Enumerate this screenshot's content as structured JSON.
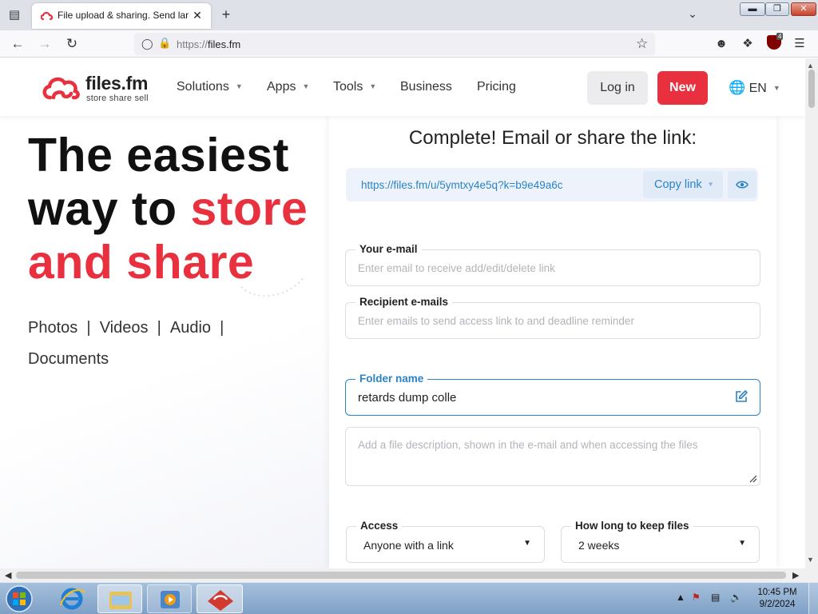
{
  "browser": {
    "tab_title": "File upload & sharing. Send large files",
    "url_scheme": "https://",
    "url_host": "files.fm",
    "ublock_count": "4"
  },
  "header": {
    "logo_name": "files.fm",
    "logo_tagline": "store  share  sell",
    "menu": {
      "solutions": "Solutions",
      "apps": "Apps",
      "tools": "Tools",
      "business": "Business",
      "pricing": "Pricing"
    },
    "login": "Log in",
    "new": "New",
    "language": "EN"
  },
  "hero": {
    "line1": "The easiest",
    "line2a": "way to ",
    "line2b": "store",
    "line3": "and share",
    "links": [
      "Photos",
      "Videos",
      "Audio",
      "Documents"
    ]
  },
  "panel": {
    "heading": "Complete! Email or share the link:",
    "share_link": "https://files.fm/u/5ymtxy4e5q?k=b9e49a6c",
    "copy_link": "Copy link",
    "email_label": "Your e-mail",
    "email_placeholder": "Enter email to receive add/edit/delete link",
    "recipients_label": "Recipient e-mails",
    "recipients_placeholder": "Enter emails to send access link to and deadline reminder",
    "folder_label": "Folder name",
    "folder_value": "retards dump colle",
    "description_placeholder": "Add a file description, shown in the e-mail and when accessing the files",
    "access_label": "Access",
    "access_value": "Anyone with a link",
    "keep_label": "How long to keep files",
    "keep_value": "2 weeks"
  },
  "taskbar": {
    "time": "10:45 PM",
    "date": "9/2/2024"
  },
  "colors": {
    "brand_red": "#e8303f",
    "link_blue": "#2a83c6"
  }
}
